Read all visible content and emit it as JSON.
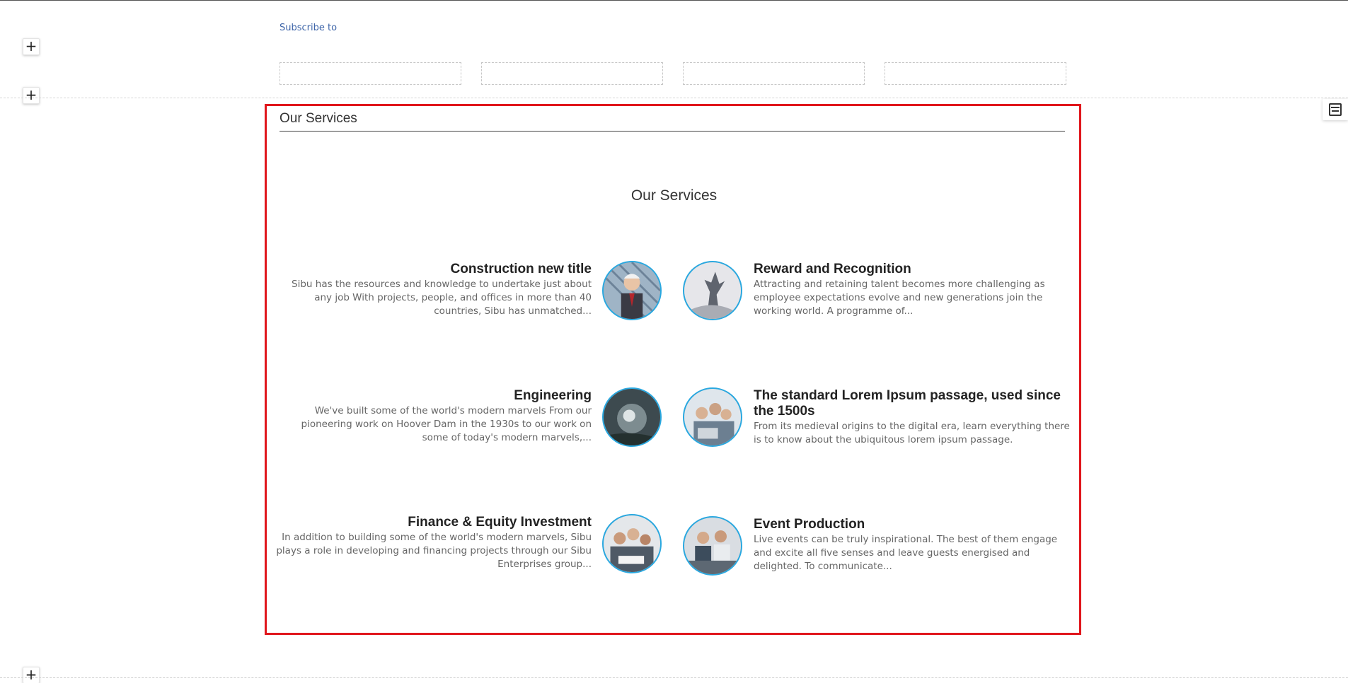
{
  "subscribe": {
    "label": "Subscribe to"
  },
  "section": {
    "title": "Our Services",
    "heading": "Our Services"
  },
  "services": [
    {
      "title": "Construction new title",
      "desc": "Sibu has the resources and knowledge to undertake just about any job With projects, people, and offices in more than 40 countries, Sibu has unmatched..."
    },
    {
      "title": "Reward and Recognition",
      "desc": "Attracting and retaining talent becomes more challenging as employee expectations evolve and new generations join the working world. A programme of..."
    },
    {
      "title": "Engineering",
      "desc": "We've built some of the world's modern marvels From our pioneering work on Hoover Dam in the 1930s to our work on some of today's modern marvels,..."
    },
    {
      "title": "The standard Lorem Ipsum passage, used since the 1500s",
      "desc": "From its medieval origins to the digital era, learn everything there is to know about the ubiquitous lorem ipsum passage."
    },
    {
      "title": "Finance & Equity Investment",
      "desc": "In addition to building some of the world's modern marvels, Sibu plays a role in developing and financing projects through our Sibu Enterprises group..."
    },
    {
      "title": "Event Production",
      "desc": "Live events can be truly inspirational. The best of them engage and excite all five senses and leave guests energised and delighted. To communicate..."
    }
  ],
  "controls": {
    "add_symbol": "+"
  },
  "colors": {
    "accent_border": "#29a8e0",
    "frame_border": "#e0161c",
    "link": "#3d64a8"
  }
}
